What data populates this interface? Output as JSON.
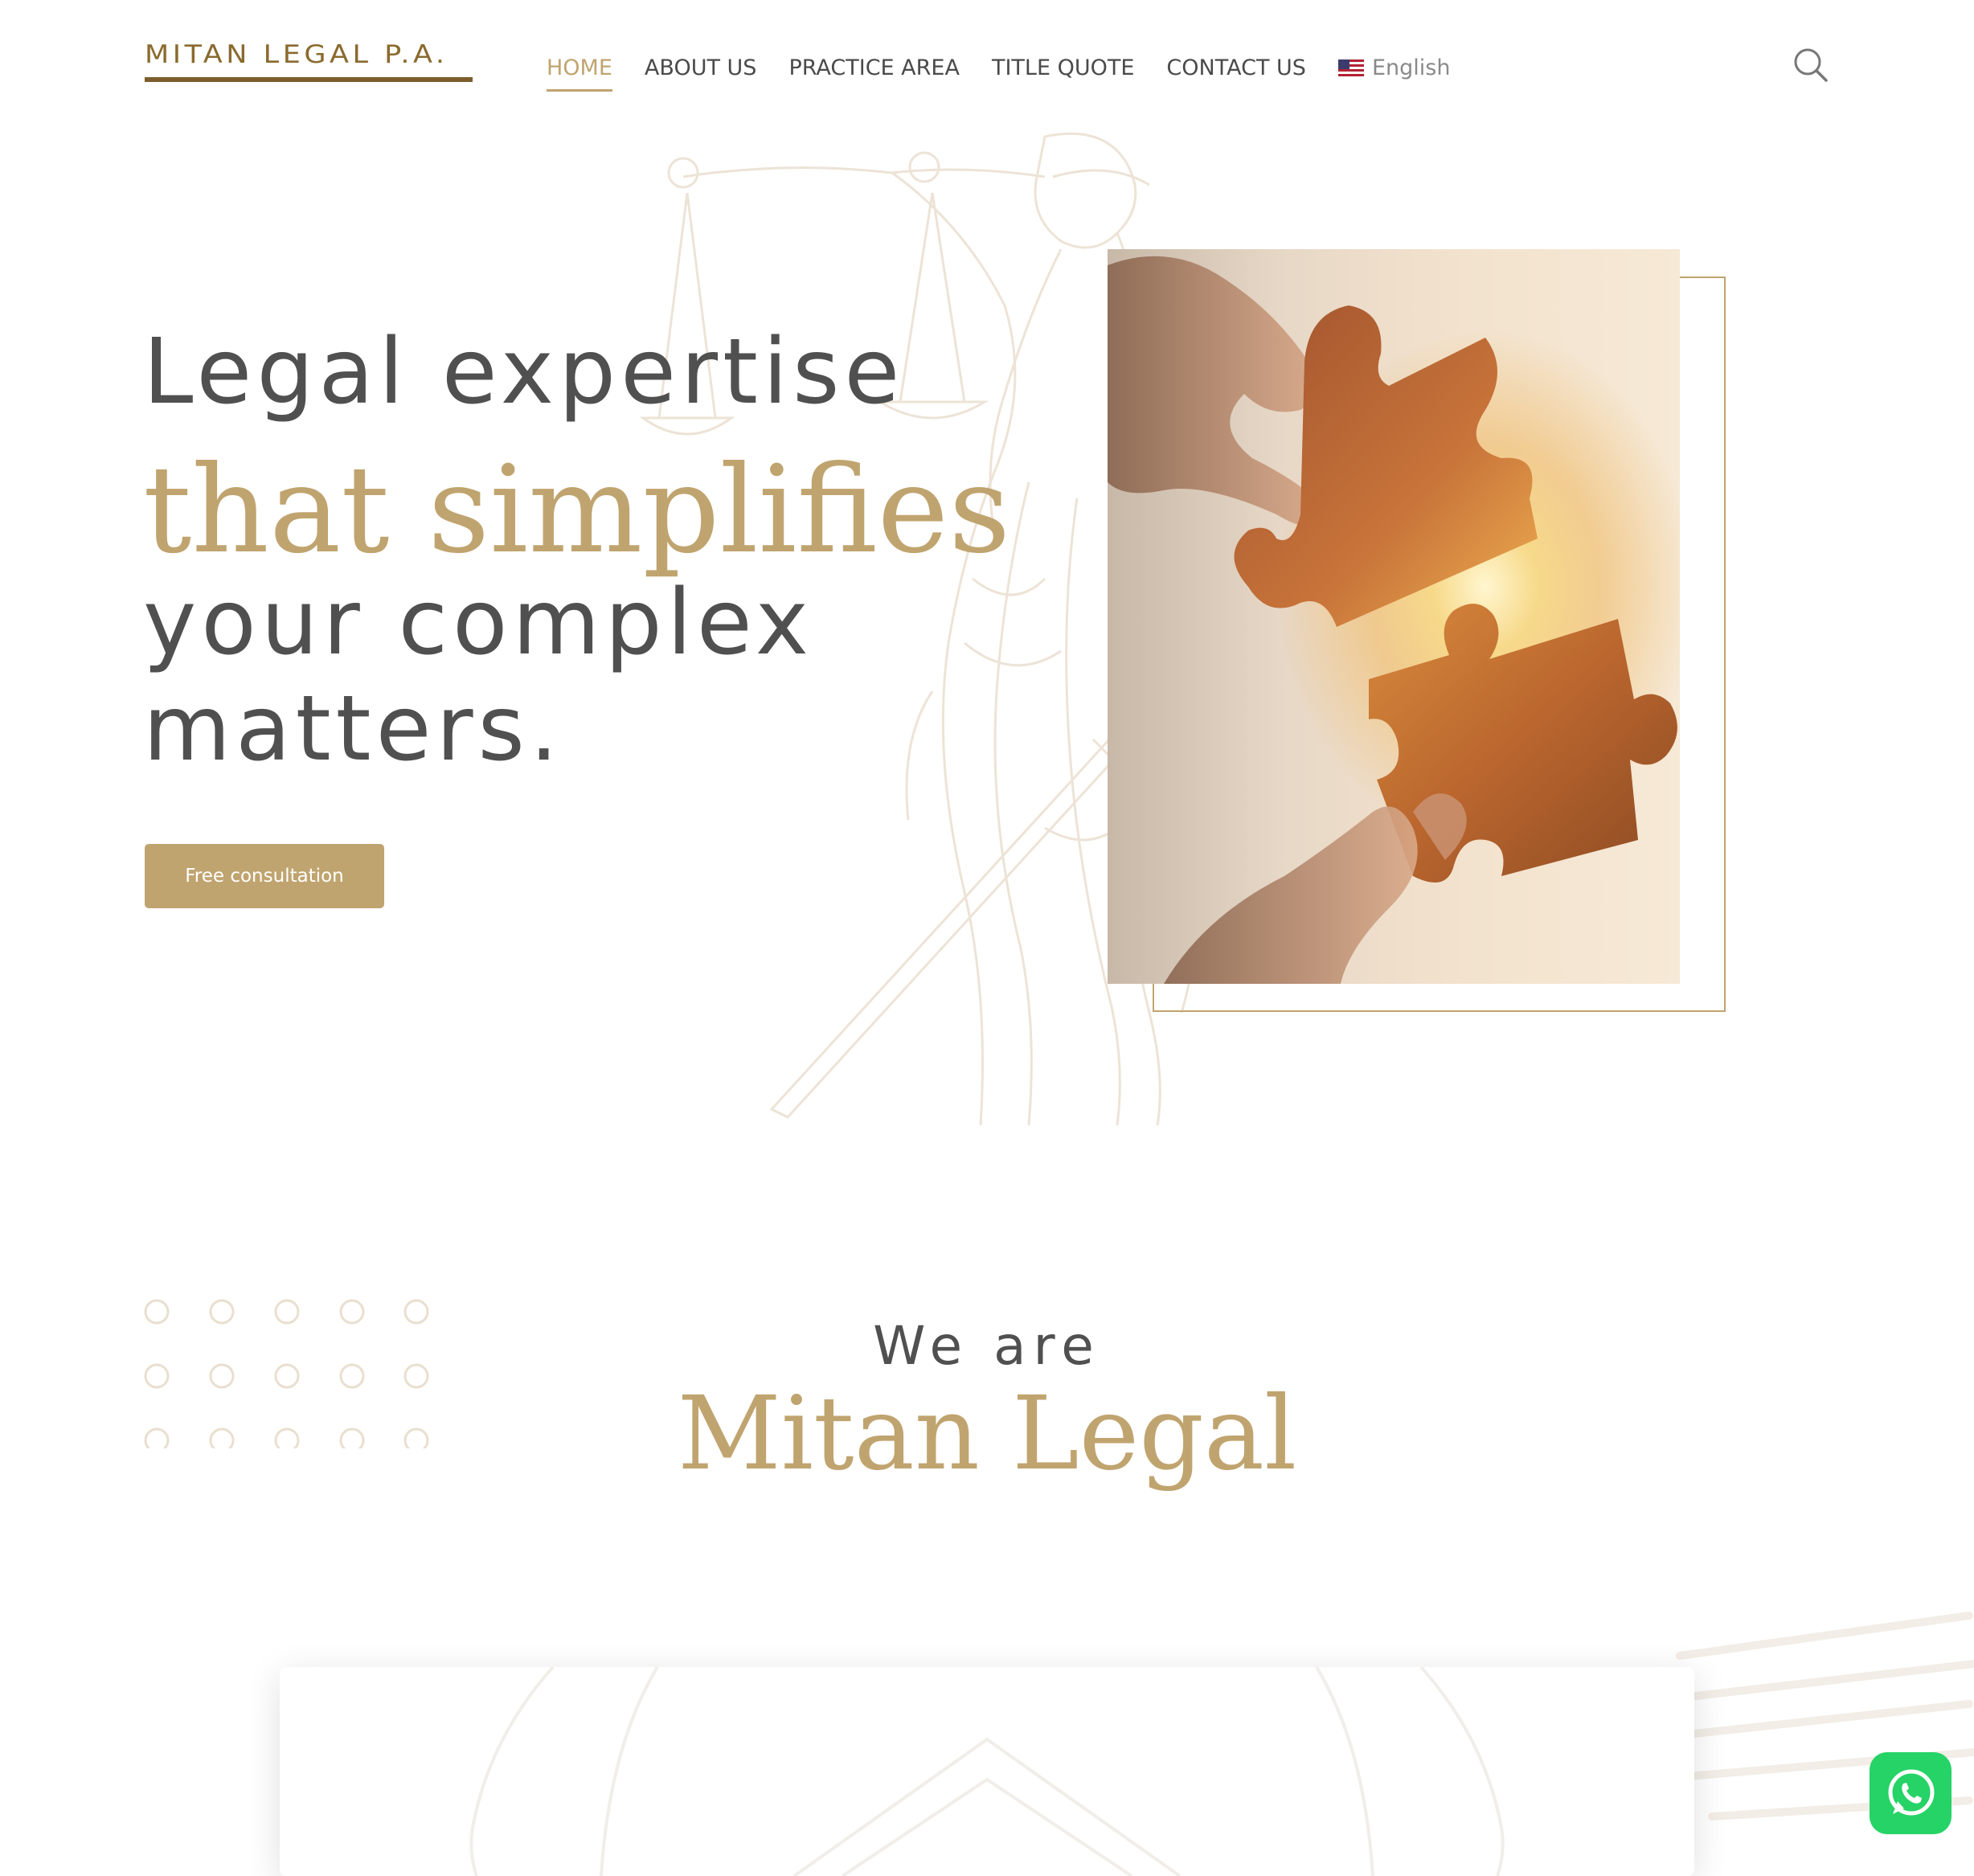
{
  "brand": {
    "logo_text": "MITAN LEGAL P.A."
  },
  "nav": {
    "items": [
      {
        "label": "HOME",
        "active": true
      },
      {
        "label": "ABOUT US",
        "active": false
      },
      {
        "label": "PRACTICE AREA",
        "active": false
      },
      {
        "label": "TITLE QUOTE",
        "active": false
      },
      {
        "label": "CONTACT US",
        "active": false
      }
    ],
    "language": {
      "label": "English",
      "flag_icon": "us-flag-icon"
    },
    "search_icon": "search-icon"
  },
  "hero": {
    "line1": "Legal expertise",
    "line2": "that simplifies",
    "line3": "your complex",
    "line4": "matters.",
    "cta_label": "Free consultation"
  },
  "about": {
    "intro": "We are",
    "name": "Mitan Legal"
  },
  "widgets": {
    "whatsapp_icon": "whatsapp-icon"
  },
  "colors": {
    "accent_gold": "#c0a46f",
    "logo_brown": "#8a6a2e",
    "text_dark": "#505050",
    "whatsapp_green": "#25d366"
  }
}
